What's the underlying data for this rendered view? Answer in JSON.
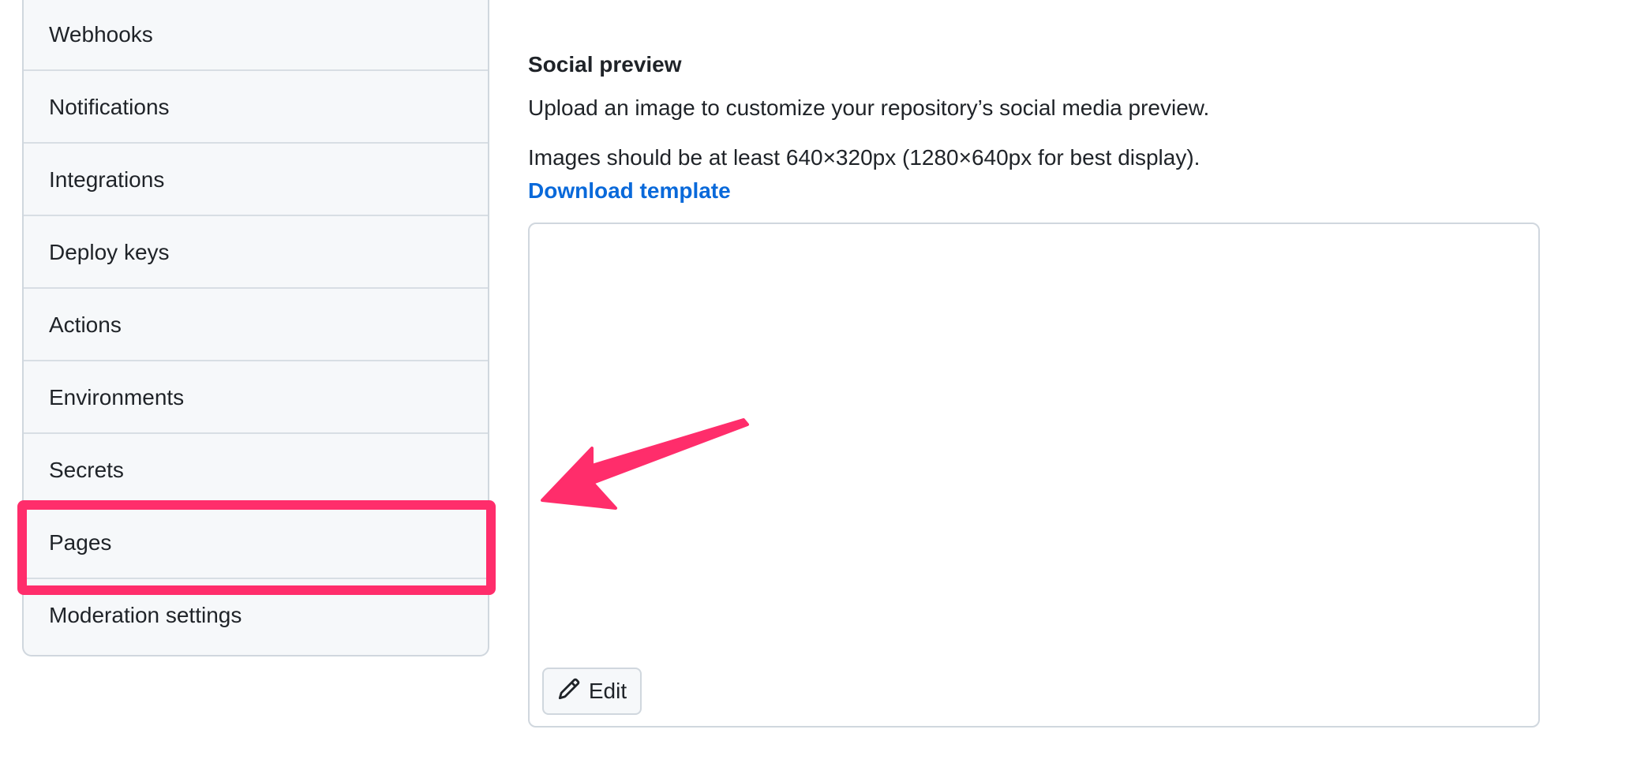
{
  "sidebar": {
    "items": [
      {
        "label": "Webhooks"
      },
      {
        "label": "Notifications"
      },
      {
        "label": "Integrations"
      },
      {
        "label": "Deploy keys"
      },
      {
        "label": "Actions"
      },
      {
        "label": "Environments"
      },
      {
        "label": "Secrets"
      },
      {
        "label": "Pages",
        "highlighted": true
      },
      {
        "label": "Moderation settings"
      }
    ]
  },
  "social_preview": {
    "title": "Social preview",
    "description": "Upload an image to customize your repository’s social media preview.",
    "hint": "Images should be at least 640×320px (1280×640px for best display).",
    "template_link": "Download template",
    "edit_label": "Edit"
  },
  "colors": {
    "highlight": "#ff2d6b",
    "link": "#0969da",
    "sidebar_bg": "#f6f8fa",
    "border": "#d0d7de"
  },
  "icons": {
    "edit": "pencil-icon",
    "annotation": "arrow-icon"
  }
}
